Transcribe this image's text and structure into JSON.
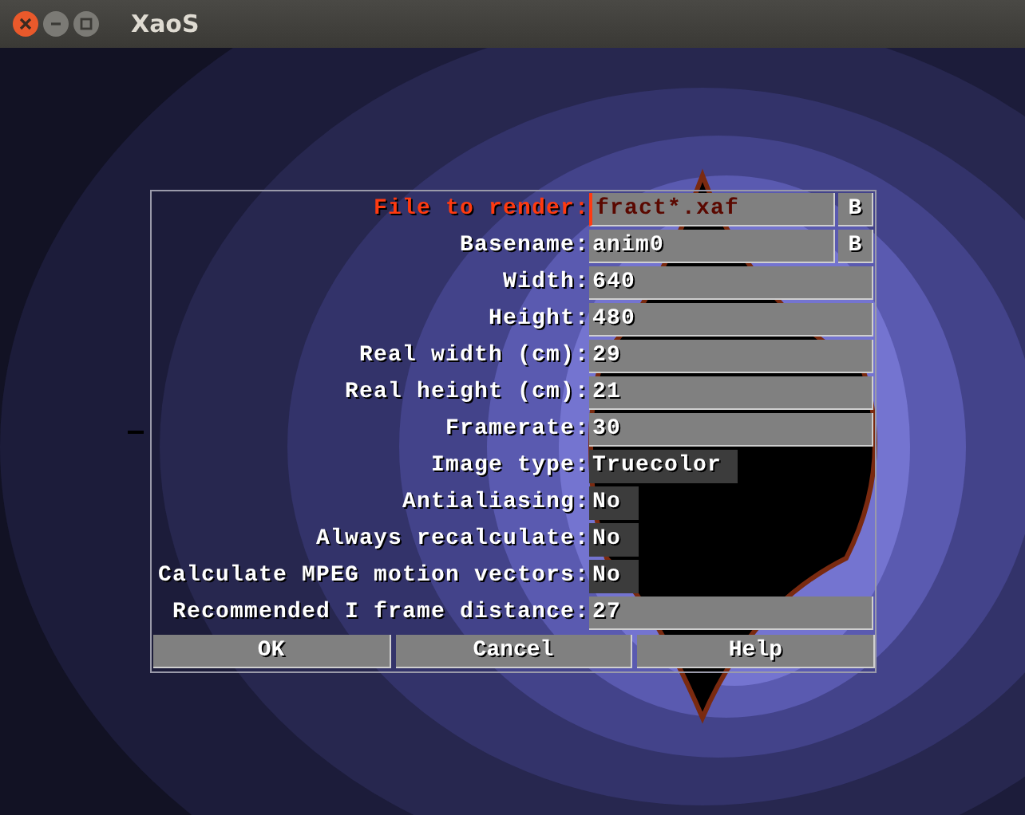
{
  "window": {
    "title": "XaoS"
  },
  "dialog": {
    "rows": [
      {
        "label": "File to render:",
        "kind": "text",
        "value": "fract*.xaf",
        "focused": true,
        "browse": "B"
      },
      {
        "label": "Basename:",
        "kind": "text",
        "value": "anim0",
        "focused": false,
        "browse": "B"
      },
      {
        "label": "Width:",
        "kind": "text",
        "value": "640",
        "focused": false
      },
      {
        "label": "Height:",
        "kind": "text",
        "value": "480",
        "focused": false
      },
      {
        "label": "Real width (cm):",
        "kind": "text",
        "value": "29",
        "focused": false
      },
      {
        "label": "Real height (cm):",
        "kind": "text",
        "value": "21",
        "focused": false
      },
      {
        "label": "Framerate:",
        "kind": "text",
        "value": "30",
        "focused": false
      },
      {
        "label": "Image type:",
        "kind": "choice",
        "value": "Truecolor",
        "focused": false
      },
      {
        "label": "Antialiasing:",
        "kind": "choice",
        "value": "No",
        "focused": false
      },
      {
        "label": "Always recalculate:",
        "kind": "choice",
        "value": "No",
        "focused": false
      },
      {
        "label": "Calculate MPEG motion vectors:",
        "kind": "choice",
        "value": "No",
        "focused": false
      },
      {
        "label": "Recommended I frame distance:",
        "kind": "text",
        "value": "27",
        "focused": false
      }
    ],
    "buttons": [
      "OK",
      "Cancel",
      "Help"
    ]
  }
}
